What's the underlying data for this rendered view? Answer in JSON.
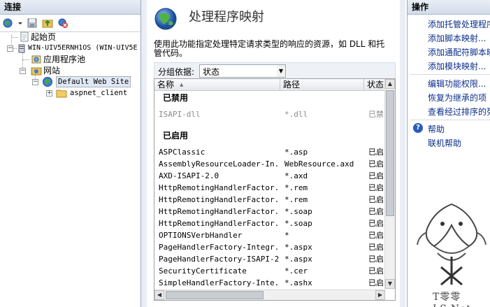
{
  "left_pane": {
    "title": "连接",
    "tree": [
      {
        "label": "起始页"
      },
      {
        "label": "WIN-UIV5ERNH1OS (WIN-UIV5E"
      },
      {
        "label": "应用程序池"
      },
      {
        "label": "网站"
      },
      {
        "label": "Default Web Site"
      },
      {
        "label": "aspnet_client"
      }
    ]
  },
  "center": {
    "title": "处理程序映射",
    "description": "使用此功能指定处理特定请求类型的响应的资源，如 DLL 和托管代码。",
    "group_by": {
      "label": "分组依据:",
      "value": "状态"
    },
    "columns": {
      "name": "名称",
      "path": "路径",
      "state": "状态"
    },
    "disabled_group": "已禁用",
    "enabled_group": "已启用",
    "disabled_rows": [
      {
        "name": "ISAPI-dll",
        "path": "*.dll",
        "state": "已禁"
      }
    ],
    "enabled_rows": [
      {
        "name": "ASPClassic",
        "path": "*.asp",
        "state": "已启"
      },
      {
        "name": "AssemblyResourceLoader-In...",
        "path": "WebResource.axd",
        "state": "已启"
      },
      {
        "name": "AXD-ISAPI-2.0",
        "path": "*.axd",
        "state": "已启"
      },
      {
        "name": "HttpRemotingHandlerFactor...",
        "path": "*.rem",
        "state": "已启"
      },
      {
        "name": "HttpRemotingHandlerFactor...",
        "path": "*.rem",
        "state": "已启"
      },
      {
        "name": "HttpRemotingHandlerFactor...",
        "path": "*.soap",
        "state": "已启"
      },
      {
        "name": "HttpRemotingHandlerFactor...",
        "path": "*.soap",
        "state": "已启"
      },
      {
        "name": "OPTIONSVerbHandler",
        "path": "*",
        "state": "已启"
      },
      {
        "name": "PageHandlerFactory-Integr...",
        "path": "*.aspx",
        "state": "已启"
      },
      {
        "name": "PageHandlerFactory-ISAPI-2.0",
        "path": "*.aspx",
        "state": "已启"
      },
      {
        "name": "SecurityCertificate",
        "path": "*.cer",
        "state": "已启"
      },
      {
        "name": "SimpleHandlerFactory-Inte...",
        "path": "*.ashx",
        "state": "已启"
      }
    ]
  },
  "right_pane": {
    "title": "操作",
    "actions": [
      "添加托管处理程序",
      "添加脚本映射...",
      "添加通配符脚本映射",
      "添加模块映射...",
      "编辑功能权限...",
      "恢复为继承的项",
      "查看经过排序的列表",
      "帮助",
      "联机帮助"
    ],
    "watermark": "T零零LS.Net"
  }
}
